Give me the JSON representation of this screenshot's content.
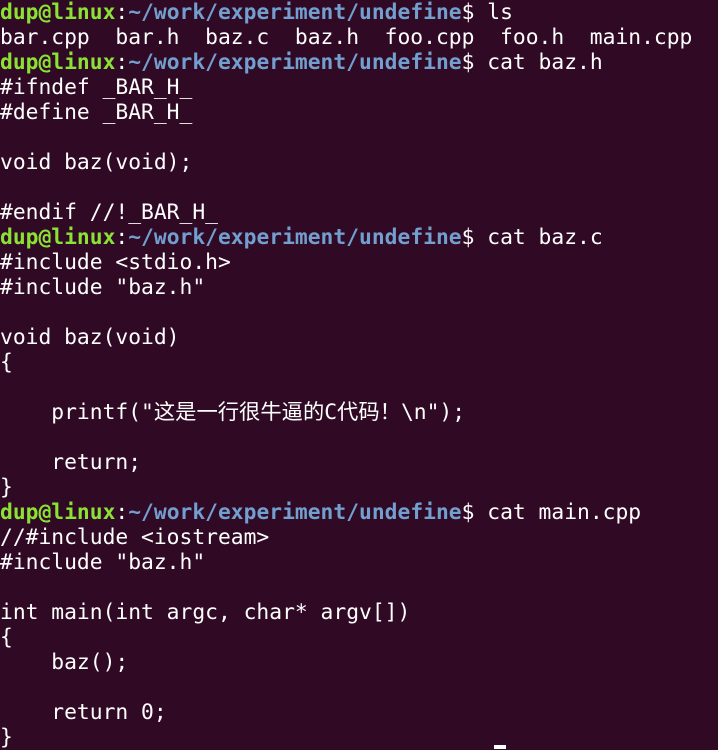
{
  "terminal": {
    "colors": {
      "background": "#300a24",
      "foreground": "#ffffff",
      "prompt_user": "#8ae234",
      "prompt_path": "#729fcf"
    },
    "prompt": {
      "user_host": "dup@linux",
      "separator": ":",
      "path": "~/work/experiment/undefine",
      "symbol": "$"
    },
    "commands": {
      "ls": " ls",
      "cat_baz_h": " cat baz.h",
      "cat_baz_c": " cat baz.c",
      "cat_main": " cat main.cpp"
    },
    "output": {
      "ls": "bar.cpp  bar.h  baz.c  baz.h  foo.cpp  foo.h  main.cpp",
      "baz_h": [
        "#ifndef _BAR_H_",
        "#define _BAR_H_",
        "",
        "void baz(void);",
        "",
        "#endif //!_BAR_H_"
      ],
      "baz_c": [
        "#include <stdio.h>",
        "#include \"baz.h\"",
        "",
        "void baz(void)",
        "{",
        "",
        "    printf(\"这是一行很牛逼的C代码！\\n\");",
        "",
        "    return;",
        "}"
      ],
      "main_cpp": [
        "//#include <iostream>",
        "#include \"baz.h\"",
        "",
        "int main(int argc, char* argv[])",
        "{",
        "    baz();",
        "",
        "    return 0;",
        "}"
      ]
    }
  }
}
